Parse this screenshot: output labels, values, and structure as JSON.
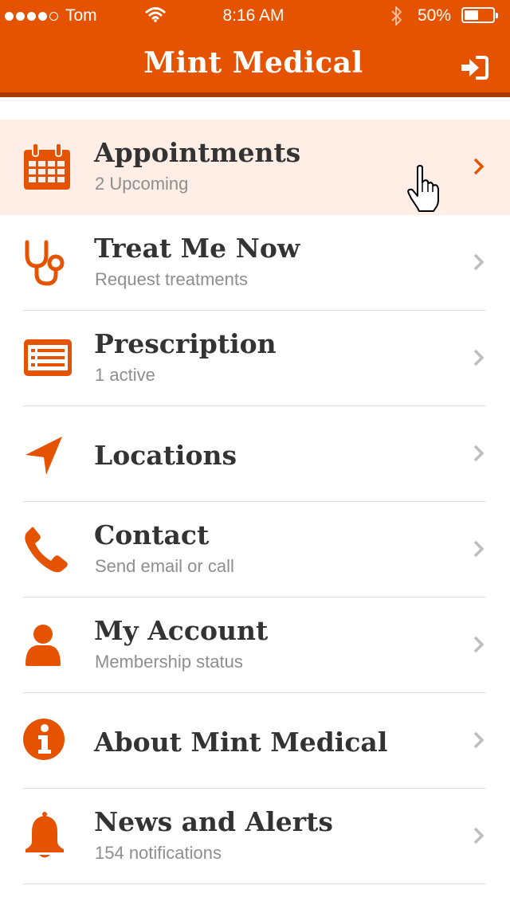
{
  "status_bar": {
    "carrier": "Tom",
    "time": "8:16 AM",
    "battery": "50%",
    "battery_level": 0.5,
    "signal_bars_filled": 4,
    "signal_bars_total": 5
  },
  "header": {
    "title": "Mint Medical",
    "login_icon": "sign-in-icon"
  },
  "colors": {
    "brand": "#E55300",
    "brand_dark": "#A63A00",
    "active_row": "#FEEEE6",
    "chevron_inactive": "#BDBDBD",
    "title_text": "#333333",
    "subtitle_text": "#8E8E8E"
  },
  "menu": {
    "items": [
      {
        "title": "Appointments",
        "subtitle": "2 Upcoming",
        "icon": "calendar-icon",
        "active": true
      },
      {
        "title": "Treat Me Now",
        "subtitle": "Request treatments",
        "icon": "stethoscope-icon",
        "active": false
      },
      {
        "title": "Prescription",
        "subtitle": "1 active",
        "icon": "prescription-list-icon",
        "active": false
      },
      {
        "title": "Locations",
        "subtitle": "",
        "icon": "location-arrow-icon",
        "active": false
      },
      {
        "title": "Contact",
        "subtitle": "Send email or call",
        "icon": "phone-icon",
        "active": false
      },
      {
        "title": "My Account",
        "subtitle": "Membership status",
        "icon": "user-icon",
        "active": false
      },
      {
        "title": "About Mint Medical",
        "subtitle": "",
        "icon": "info-icon",
        "active": false
      },
      {
        "title": "News and Alerts",
        "subtitle": "154 notifications",
        "icon": "bell-icon",
        "active": false
      }
    ]
  }
}
